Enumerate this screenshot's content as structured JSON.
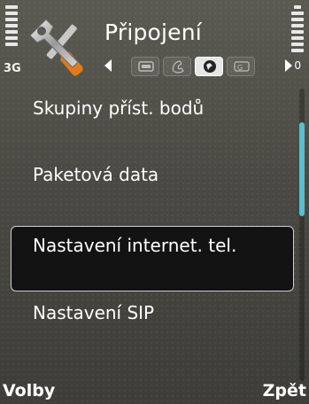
{
  "status": {
    "network": "3G",
    "signal_bars": 7,
    "battery_bars": 7
  },
  "header": {
    "title": "Připojení",
    "app_icon": "wrench-screwdriver-icon",
    "tabs": [
      {
        "icon": "settings-icon",
        "active": false
      },
      {
        "icon": "phone-icon",
        "active": false
      },
      {
        "icon": "globe-icon",
        "active": true
      },
      {
        "icon": "gprs-icon",
        "active": false
      }
    ],
    "pager": "0"
  },
  "list": {
    "items": [
      {
        "label": "Skupiny příst. bodů",
        "selected": false
      },
      {
        "label": "Paketová data",
        "selected": false
      },
      {
        "label": "Nastavení internet. tel.",
        "selected": true
      },
      {
        "label": "Nastavení SIP",
        "selected": false
      }
    ]
  },
  "scroll": {
    "position": 0.25,
    "visible_fraction": 0.32
  },
  "softkeys": {
    "left": "Volby",
    "right": "Zpět"
  },
  "colors": {
    "scrollbar": "#57bfd0",
    "selection": "#131313"
  }
}
